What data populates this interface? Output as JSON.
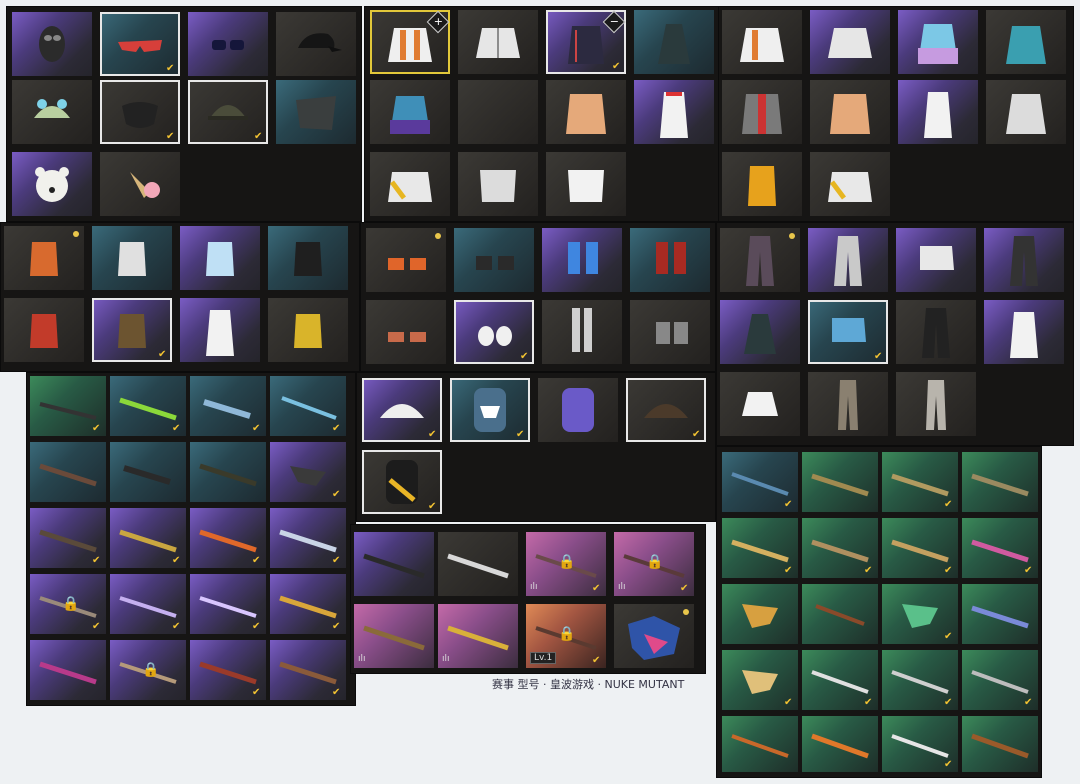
{
  "screenshot": {
    "lock_glyph": "🔒",
    "check_glyph": "✔",
    "plus_glyph": "+",
    "minus_glyph": "−",
    "level_label": "Lv.1",
    "bars_glyph": "ılı",
    "footer_caption": "赛事 型号 · 皇波游戏 · NUKE MUTANT"
  },
  "colors": {
    "accent_yellow": "#f1c232",
    "selected_white": "#e8e8e8",
    "selected_yellow": "#e2c83a",
    "panel_bg": "#161514"
  }
}
